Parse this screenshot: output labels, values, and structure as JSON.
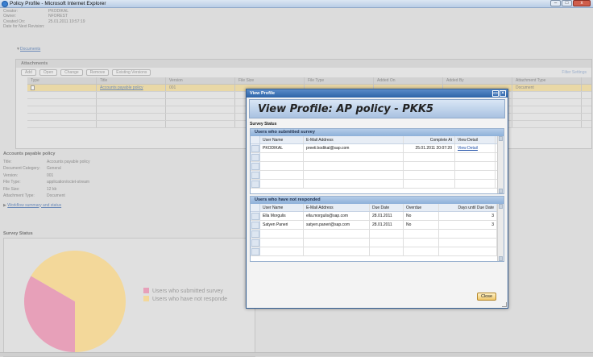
{
  "window": {
    "title": "Policy Profile - Microsoft Internet Explorer",
    "controls": [
      "–",
      "□",
      "x"
    ]
  },
  "meta": [
    {
      "label": "Creator:",
      "value": "PKODIKAL"
    },
    {
      "label": "Owner:",
      "value": "NFOREST"
    },
    {
      "label": "Created On:",
      "value": "25.01.2011 19:57:19"
    },
    {
      "label": "Date for Next Revision:",
      "value": ""
    }
  ],
  "documents_link": "Documents",
  "attachments": {
    "title": "Attachments",
    "buttons": [
      "Add",
      "Open",
      "Change",
      "Remove",
      "Existing Versions"
    ],
    "filter_settings": "Filter  Settings",
    "columns": [
      "Type",
      "Title",
      "Version",
      "File Size",
      "File Type",
      "Added On",
      "Added By",
      "Attachment Type"
    ],
    "rows": [
      {
        "title": "Accounts payable policy",
        "version": "001",
        "attachment_type": "Document"
      }
    ]
  },
  "details": {
    "title": "Accounts payable policy",
    "fields": [
      {
        "label": "Title:",
        "value": "Accounts payable policy"
      },
      {
        "label": "Document Category:",
        "value": "General"
      },
      {
        "label": "Version:",
        "value": "001"
      },
      {
        "label": "File Type:",
        "value": "application/octet-stream"
      },
      {
        "label": "File Size:",
        "value": "12 kb"
      },
      {
        "label": "Attachment Type:",
        "value": "Document"
      }
    ],
    "workflow_link": "Workflow summary and status"
  },
  "survey": {
    "label": "Survey Status",
    "legend": [
      {
        "label": "Users who submitted survey",
        "color": "#e7a0b9"
      },
      {
        "label": "Users who have not responde",
        "color": "#f3d89a"
      }
    ],
    "chart_data": {
      "type": "pie",
      "values": [
        1,
        2
      ],
      "labels": [
        "Users who submitted survey",
        "Users who have not responded"
      ],
      "colors": [
        "#e7a0b9",
        "#f3d89a"
      ]
    }
  },
  "modal": {
    "window_title": "View Profile",
    "heading": "View Profile: AP policy - PKK5",
    "section_label": "Survey Status",
    "submitted": {
      "title": "Users who submitted survey",
      "columns": [
        "User Name",
        "E-Mail Address",
        "Complete At",
        "View Detail"
      ],
      "rows": [
        {
          "user": "PKODIKAL",
          "email": "preeti.kodikal@sap.com",
          "complete_at": "25.01.2011 20:07:20",
          "view": "View Detail"
        }
      ]
    },
    "not_responded": {
      "title": "Users who have not responded",
      "columns": [
        "User Name",
        "E-Mail Address",
        "Due Date",
        "Overdue",
        "Days until Due Date"
      ],
      "rows": [
        {
          "user": "Ella Morgulis",
          "email": "ella.morgulis@sap.com",
          "due": "28.01.2011",
          "overdue": "No",
          "days": "3"
        },
        {
          "user": "Satyen Paneri",
          "email": "satyen.paneri@sap.com",
          "due": "28.01.2011",
          "overdue": "No",
          "days": "3"
        }
      ]
    },
    "close_label": "Close"
  }
}
